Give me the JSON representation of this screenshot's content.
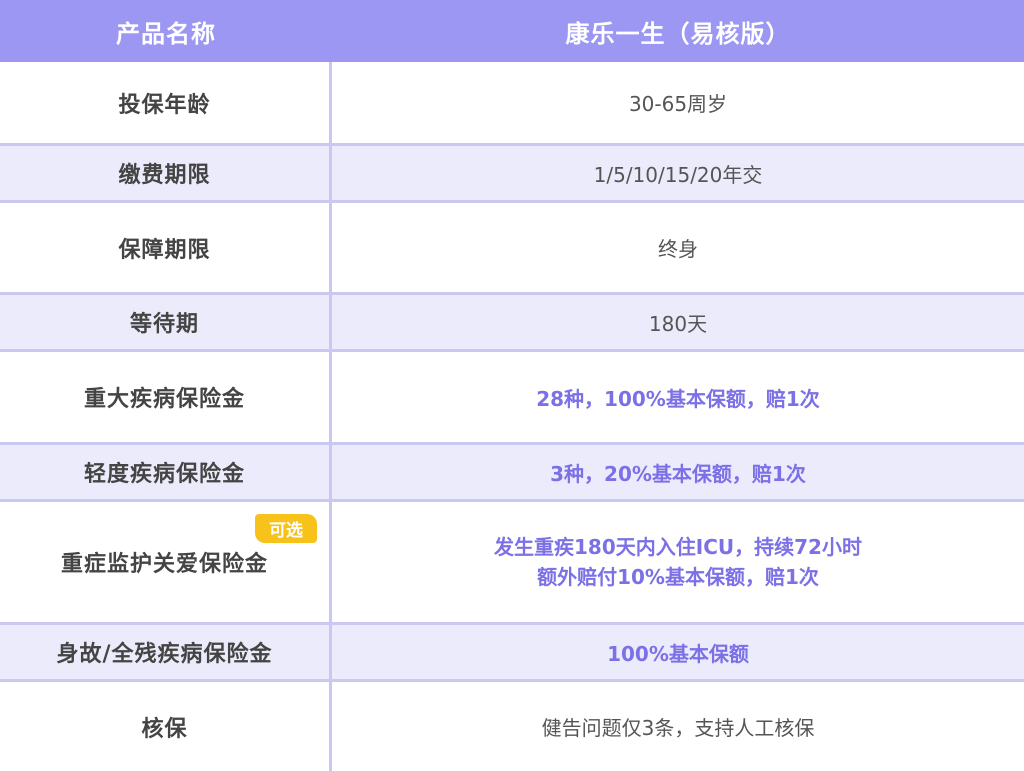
{
  "header": {
    "left": "产品名称",
    "right": "康乐一生（易核版）"
  },
  "rows": [
    {
      "label": "投保年龄",
      "value": "30-65周岁"
    },
    {
      "label": "缴费期限",
      "value": "1/5/10/15/20年交"
    },
    {
      "label": "保障期限",
      "value": "终身"
    },
    {
      "label": "等待期",
      "value": "180天"
    },
    {
      "label": "重大疾病保险金",
      "value": "28种，100%基本保额，赔1次"
    },
    {
      "label": "轻度疾病保险金",
      "value": "3种，20%基本保额，赔1次"
    },
    {
      "label": "重症监护关爱保险金",
      "badge": "可选",
      "value_line1": "发生重疾180天内入住ICU，持续72小时",
      "value_line2": "额外赔付10%基本保额，赔1次"
    },
    {
      "label": "身故/全残疾病保险金",
      "value": "100%基本保额"
    },
    {
      "label": "核保",
      "value": "健告问题仅3条，支持人工核保"
    }
  ],
  "colors": {
    "header_bg": "#9b97f3",
    "shade_bg": "#ecebfb",
    "highlight_text": "#7c70e6",
    "badge_bg": "#f7c21a"
  }
}
